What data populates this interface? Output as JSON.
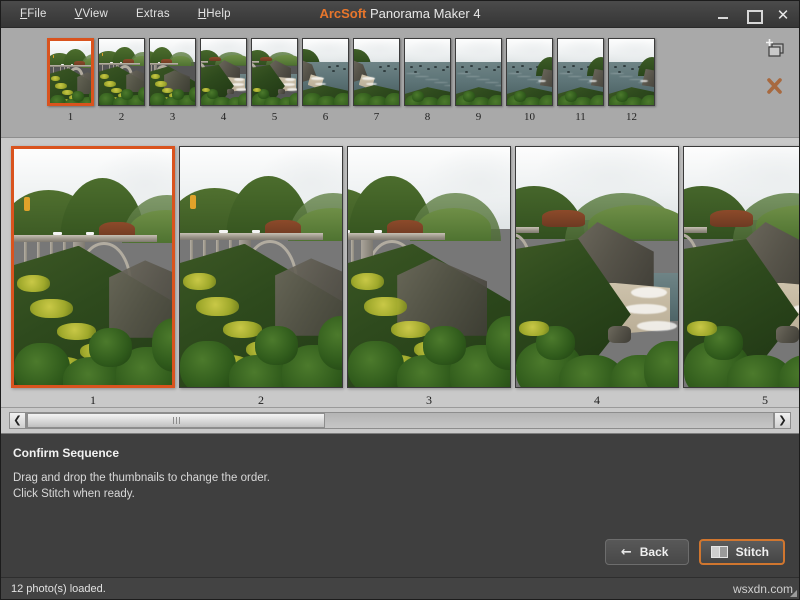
{
  "window": {
    "title_brand": "ArcSoft",
    "title_rest": " Panorama Maker 4",
    "minimize_label": "",
    "maximize_label": "",
    "close_label": "✕"
  },
  "menu": {
    "items": [
      {
        "name": "file",
        "label": "File",
        "accel": "F"
      },
      {
        "name": "view",
        "label": "View",
        "accel": "V"
      },
      {
        "name": "extras",
        "label": "Extras",
        "accel": "x"
      },
      {
        "name": "help",
        "label": "Help",
        "accel": "H"
      }
    ]
  },
  "filmstrip": {
    "selected_index": 1,
    "thumbnails": [
      {
        "num": "1",
        "scene": "bridge-near"
      },
      {
        "num": "2",
        "scene": "bridge-near"
      },
      {
        "num": "3",
        "scene": "bridge-mid"
      },
      {
        "num": "4",
        "scene": "coast-beach"
      },
      {
        "num": "5",
        "scene": "coast-beach"
      },
      {
        "num": "6",
        "scene": "coast-ocean"
      },
      {
        "num": "7",
        "scene": "coast-ocean"
      },
      {
        "num": "8",
        "scene": "ocean-open"
      },
      {
        "num": "9",
        "scene": "ocean-open"
      },
      {
        "num": "10",
        "scene": "ocean-right"
      },
      {
        "num": "11",
        "scene": "ocean-right"
      },
      {
        "num": "12",
        "scene": "ocean-right"
      }
    ],
    "tools": [
      {
        "name": "add-photos",
        "icon": "add-photos-icon",
        "tip": "Add Photos"
      },
      {
        "name": "remove-photo",
        "icon": "remove-x-icon",
        "tip": "Remove Photo"
      }
    ]
  },
  "preview": {
    "selected_index": 1,
    "panels": [
      {
        "num": "1",
        "scene": "bridge-near"
      },
      {
        "num": "2",
        "scene": "bridge-near"
      },
      {
        "num": "3",
        "scene": "bridge-mid"
      },
      {
        "num": "4",
        "scene": "coast-beach"
      },
      {
        "num": "5",
        "scene": "coast-beach"
      }
    ]
  },
  "scrollbar": {
    "left_arrow": "❮",
    "right_arrow": "❯",
    "thumb_percent": 40
  },
  "instructions": {
    "heading": "Confirm Sequence",
    "line1": "Drag and drop the thumbnails to change the order.",
    "line2": "Click Stitch when ready."
  },
  "actions": {
    "back_label": "Back",
    "back_arrow": "←",
    "stitch_label": "Stitch"
  },
  "statusbar": {
    "text": "12 photo(s) loaded.",
    "watermark": "wsxdn.com"
  },
  "colors": {
    "accent": "#d9531e",
    "brand": "#e8762c",
    "panel_bg": "#c9c9c9",
    "strip_bg": "#a9a9a9",
    "chrome_bg": "#3f3f3f"
  }
}
